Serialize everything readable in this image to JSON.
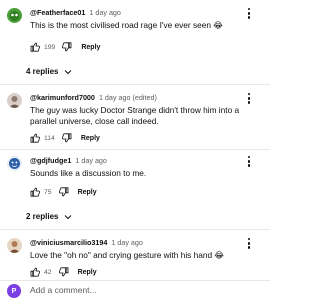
{
  "comments": [
    {
      "handle": "@Featherface01",
      "time": "1 day ago",
      "text": "This is the most civilised road rage I've ever seen 😂",
      "likes": "199",
      "reply_label": "Reply",
      "avatar_color": "#4a9e3a"
    },
    {
      "handle": "@karimunford7000",
      "time": "1 day ago (edited)",
      "text": "The guy was lucky Doctor Strange didn't throw him into a parallel universe, close call indeed.",
      "likes": "114",
      "reply_label": "Reply",
      "avatar_color": "#8c7a70"
    },
    {
      "handle": "@gdjfudge1",
      "time": "1 day ago",
      "text": "Sounds like a discussion to me.",
      "likes": "75",
      "reply_label": "Reply",
      "avatar_color": "#2a5ea8"
    },
    {
      "handle": "@viniciusmarcilio3194",
      "time": "1 day ago",
      "text": "Love the \"oh no\" and crying gesture with his hand 😂",
      "likes": "42",
      "reply_label": "Reply",
      "avatar_color": "#b07a55"
    }
  ],
  "replies_toggles": [
    "4 replies",
    "2 replies"
  ],
  "add_comment": {
    "avatar_letter": "P",
    "placeholder": "Add a comment...",
    "avatar_color": "#7b3fe4"
  }
}
